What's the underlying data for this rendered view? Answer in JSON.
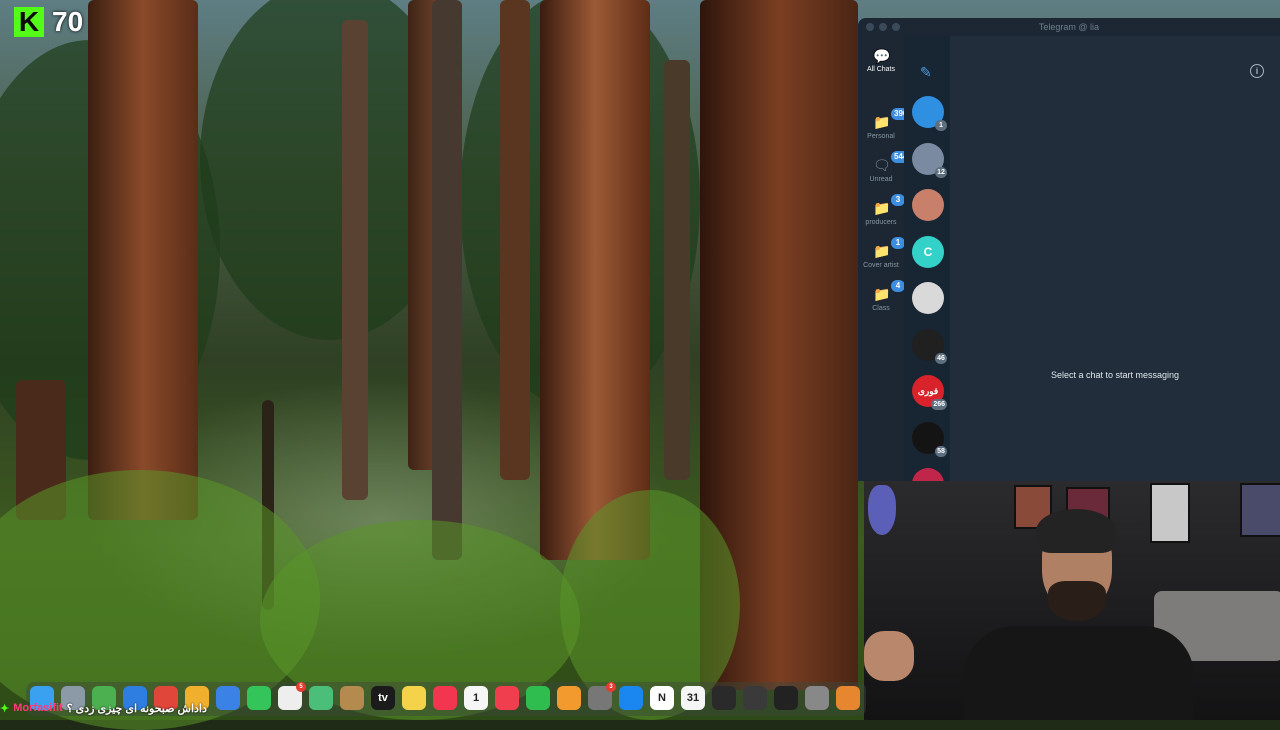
{
  "stream": {
    "platform_logo": "K",
    "viewer_count": "70"
  },
  "telegram": {
    "window_title": "Telegram @ lia",
    "folders": [
      {
        "label": "All Chats",
        "badge": "",
        "icon": "chats-icon",
        "active": true
      },
      {
        "label": "Personal",
        "badge": "396",
        "icon": "folder-icon"
      },
      {
        "label": "Unread",
        "badge": "544",
        "icon": "chat-bubble-icon"
      },
      {
        "label": "producers",
        "badge": "3",
        "icon": "folder-icon"
      },
      {
        "label": "Cover artist",
        "badge": "1",
        "icon": "folder-icon"
      },
      {
        "label": "Class",
        "badge": "4",
        "icon": "folder-icon"
      }
    ],
    "chats": [
      {
        "initial": "",
        "badge": "1",
        "color": "#2f8fe0"
      },
      {
        "initial": "",
        "badge": "12",
        "color": "#7a8aa0"
      },
      {
        "initial": "",
        "badge": "",
        "color": "#c8806a"
      },
      {
        "initial": "C",
        "badge": "",
        "color": "#33d1c8"
      },
      {
        "initial": "",
        "badge": "",
        "color": "#d9d9d9"
      },
      {
        "initial": "",
        "badge": "46",
        "color": "#202020"
      },
      {
        "initial": "فوری",
        "badge": "266",
        "color": "#d8232a"
      },
      {
        "initial": "",
        "badge": "58",
        "color": "#141414"
      },
      {
        "initial": "",
        "badge": "",
        "color": "#c0264a"
      }
    ],
    "empty_state": "Select a chat to start messaging"
  },
  "dock": {
    "apps": [
      {
        "name": "finder-icon",
        "label": "",
        "color": "#3aa0f0"
      },
      {
        "name": "launchpad-icon",
        "label": "",
        "color": "#8c9aa8"
      },
      {
        "name": "chrome-icon-green",
        "label": "",
        "color": "#4caf50"
      },
      {
        "name": "safari-icon",
        "label": "",
        "color": "#2e7de0"
      },
      {
        "name": "chrome-icon",
        "label": "",
        "color": "#e0463a"
      },
      {
        "name": "photos-icon",
        "label": "",
        "color": "#f0b02e"
      },
      {
        "name": "mail-icon",
        "label": "",
        "color": "#3b82e6"
      },
      {
        "name": "messages-icon",
        "label": "",
        "color": "#33c45a"
      },
      {
        "name": "reminders-icon",
        "label": "",
        "color": "#eeeeee",
        "badge": "5"
      },
      {
        "name": "maps-icon",
        "label": "",
        "color": "#4bbf7a"
      },
      {
        "name": "box-icon",
        "label": "",
        "color": "#b48a4e"
      },
      {
        "name": "tv-icon",
        "label": "tv",
        "color": "#1b1b1b"
      },
      {
        "name": "notes-icon",
        "label": "",
        "color": "#f4d34a"
      },
      {
        "name": "music-icon",
        "label": "",
        "color": "#f2364f"
      },
      {
        "name": "calendar-icon",
        "label": "1",
        "color": "#f6f6f6"
      },
      {
        "name": "news-icon",
        "label": "",
        "color": "#f13e4e"
      },
      {
        "name": "numbers-icon",
        "label": "",
        "color": "#2ebd4e"
      },
      {
        "name": "pages-icon",
        "label": "",
        "color": "#f29a2e"
      },
      {
        "name": "settings-icon",
        "label": "",
        "color": "#777777",
        "badge": "3"
      },
      {
        "name": "app-store-icon",
        "label": "",
        "color": "#1a86f0"
      },
      {
        "name": "notion-icon",
        "label": "N",
        "color": "#ffffff"
      },
      {
        "name": "calendar31-icon",
        "label": "31",
        "color": "#f5f5f5"
      },
      {
        "name": "logic-icon",
        "label": "",
        "color": "#2a2a2a"
      },
      {
        "name": "audio-icon",
        "label": "",
        "color": "#3a3a3a"
      },
      {
        "name": "unity-icon",
        "label": "",
        "color": "#222222"
      },
      {
        "name": "compressor-icon",
        "label": "",
        "color": "#888888"
      },
      {
        "name": "fl-studio-icon",
        "label": "",
        "color": "#e6862e"
      }
    ]
  },
  "chat_ticker": {
    "username": "Morfasifit",
    "message": "داداش صبحونه ای چیزی زدی ؟"
  }
}
